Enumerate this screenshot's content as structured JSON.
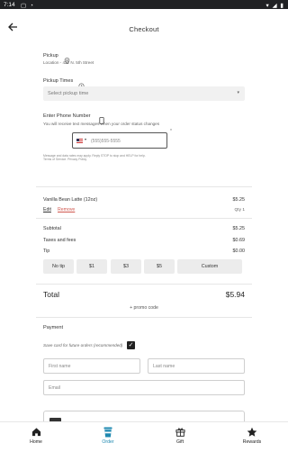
{
  "status_bar": {
    "time": "7:14"
  },
  "header": {
    "title": "Checkout"
  },
  "pickup": {
    "label": "Pickup",
    "location": "Location - 422 N. 5th Street"
  },
  "pickup_times": {
    "label": "Pickup Times",
    "placeholder": "Select pickup time"
  },
  "phone": {
    "label": "Enter Phone Number",
    "description": "You will receive text messages when your order status changes",
    "placeholder": "(555)555-5555",
    "asterisk": "*",
    "disclaimer_1": "Message and data rates may apply. Reply STOP to stop and HELP for help.",
    "disclaimer_2": "Terms of Service. Privacy Policy"
  },
  "order": {
    "item_name": "Vanilla Bean Latte (12oz)",
    "item_price": "$5.25",
    "edit_label": "Edit",
    "remove_label": "Remove",
    "qty": "Qty 1"
  },
  "summary": {
    "subtotal_label": "Subtotal",
    "subtotal_value": "$5.25",
    "taxes_label": "Taxes and fees",
    "taxes_value": "$0.69",
    "tip_label": "Tip",
    "tip_value": "$0.00"
  },
  "tip_options": [
    "No tip",
    "$1",
    "$3",
    "$5",
    "Custom"
  ],
  "total": {
    "label": "Total",
    "value": "$5.94"
  },
  "promo": {
    "label": "+ promo code"
  },
  "payment": {
    "title": "Payment",
    "save_card_label": "Save card for future orders (recommended)",
    "save_card_checked": true,
    "first_name_placeholder": "First name",
    "last_name_placeholder": "Last name",
    "email_placeholder": "Email"
  },
  "bottom_nav": [
    {
      "label": "Home",
      "icon": "home-icon",
      "active": false
    },
    {
      "label": "Order",
      "icon": "cup-icon",
      "active": true
    },
    {
      "label": "Gift",
      "icon": "gift-icon",
      "active": false
    },
    {
      "label": "Rewards",
      "icon": "star-icon",
      "active": false
    }
  ],
  "colors": {
    "accent": "#1e88b0",
    "remove": "#d0584f"
  }
}
